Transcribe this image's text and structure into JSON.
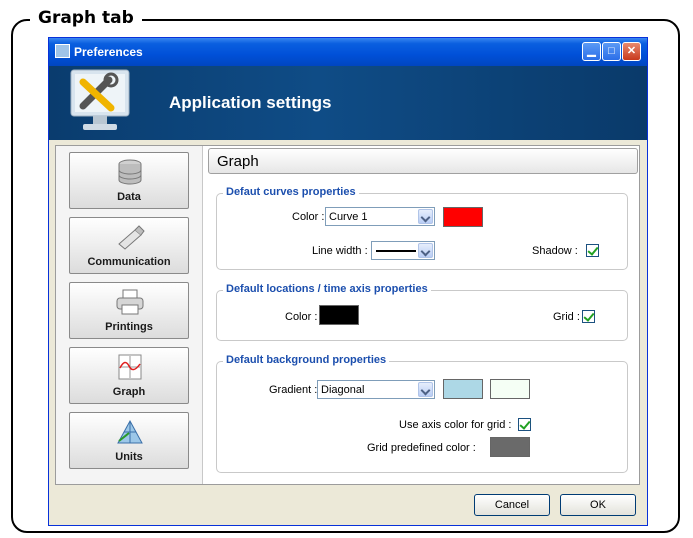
{
  "caption": "Graph tab",
  "window": {
    "title": "Preferences",
    "minimize_glyph": "▁",
    "maximize_glyph": "□",
    "close_glyph": "✕"
  },
  "banner": {
    "title": "Application settings",
    "icon": "tools-monitor-icon"
  },
  "nav": {
    "items": [
      {
        "label": "Data",
        "icon": "database-icon"
      },
      {
        "label": "Communication",
        "icon": "usb-icon"
      },
      {
        "label": "Printings",
        "icon": "printer-icon"
      },
      {
        "label": "Graph",
        "icon": "graph-icon",
        "selected": true
      },
      {
        "label": "Units",
        "icon": "units-icon"
      }
    ]
  },
  "panel": {
    "title": "Graph",
    "curves": {
      "title": "Defaut curves properties",
      "color_label": "Color :",
      "color_value": "Curve 1",
      "color_swatch": "#ff0000",
      "line_width_label": "Line width :",
      "shadow_label": "Shadow :",
      "shadow_checked": true
    },
    "axis": {
      "title": "Default locations / time axis properties",
      "color_label": "Color :",
      "color_swatch": "#000000",
      "grid_label": "Grid :",
      "grid_checked": true
    },
    "background": {
      "title": "Default background properties",
      "gradient_label": "Gradient :",
      "gradient_value": "Diagonal",
      "swatch1": "#add8e6",
      "swatch2": "#f5fff5",
      "use_axis_label": "Use axis color for grid :",
      "use_axis_checked": true,
      "predefined_label": "Grid predefined color :",
      "predefined_swatch": "#6a6a6a"
    }
  },
  "buttons": {
    "cancel": "Cancel",
    "ok": "OK"
  }
}
